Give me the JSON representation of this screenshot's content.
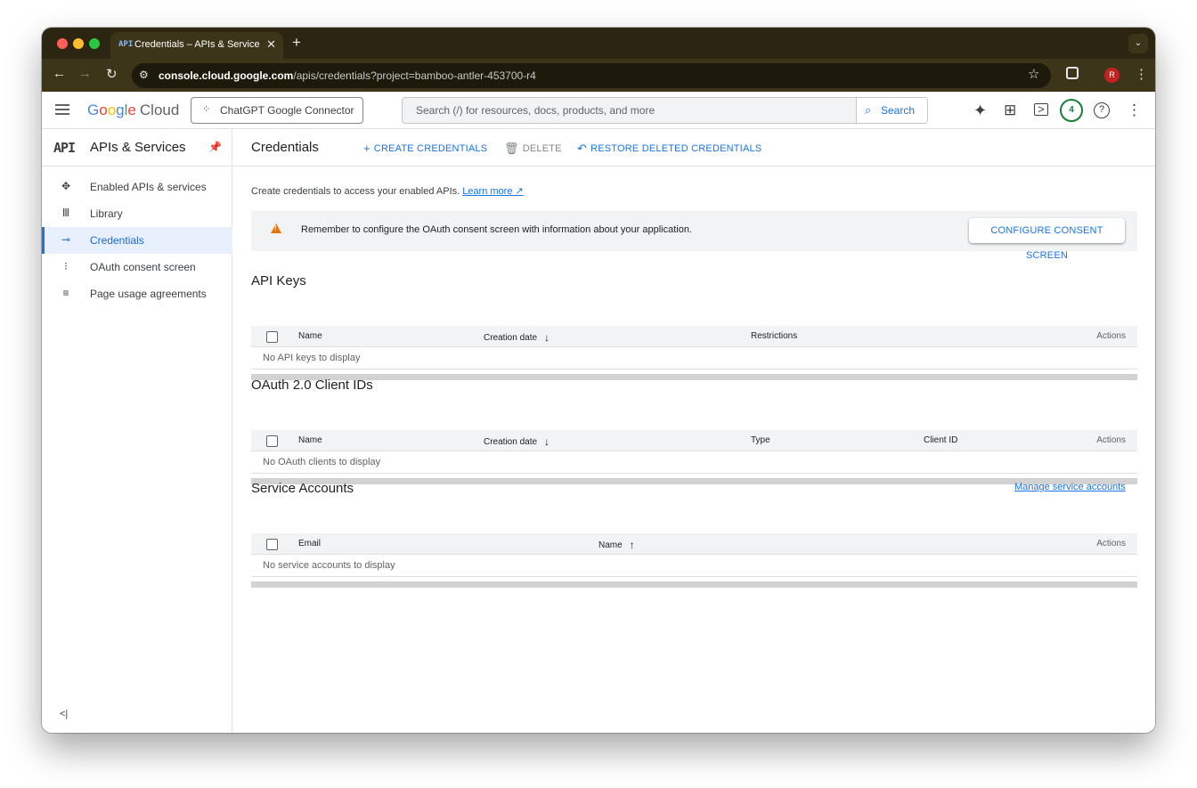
{
  "browser": {
    "tab_title": "Credentials – APIs & Services",
    "tab_favicon": "API",
    "url_host": "console.cloud.google.com",
    "url_path": "/apis/credentials?project=bamboo-antler-453700-r4",
    "avatar_letter": "R"
  },
  "header": {
    "logo_google": [
      "G",
      "o",
      "o",
      "g",
      "l",
      "e"
    ],
    "logo_cloud": "Cloud",
    "project_name": "ChatGPT Google Connector",
    "search_placeholder": "Search (/) for resources, docs, products, and more",
    "search_button": "Search",
    "notification_count": "4"
  },
  "sidebar": {
    "api_logo": "API",
    "title": "APIs & Services",
    "items": [
      {
        "label": "Enabled APIs & services",
        "icon": "enabled-apis-icon"
      },
      {
        "label": "Library",
        "icon": "library-icon"
      },
      {
        "label": "Credentials",
        "icon": "key-icon",
        "active": true
      },
      {
        "label": "OAuth consent screen",
        "icon": "oauth-consent-icon"
      },
      {
        "label": "Page usage agreements",
        "icon": "agreements-icon"
      }
    ]
  },
  "main": {
    "title": "Credentials",
    "toolbar": {
      "create": "CREATE CREDENTIALS",
      "delete": "DELETE",
      "restore": "RESTORE DELETED CREDENTIALS"
    },
    "intro_text": "Create credentials to access your enabled APIs.",
    "learn_more": "Learn more",
    "banner_text": "Remember to configure the OAuth consent screen with information about your application.",
    "banner_button": "CONFIGURE CONSENT SCREEN",
    "api_keys": {
      "title": "API Keys",
      "columns": [
        "Name",
        "Creation date",
        "Restrictions",
        "Actions"
      ],
      "empty": "No API keys to display"
    },
    "oauth": {
      "title": "OAuth 2.0 Client IDs",
      "columns": [
        "Name",
        "Creation date",
        "Type",
        "Client ID",
        "Actions"
      ],
      "empty": "No OAuth clients to display"
    },
    "service_accounts": {
      "title": "Service Accounts",
      "manage_link": "Manage service accounts",
      "columns": [
        "Email",
        "Name",
        "Actions"
      ],
      "empty": "No service accounts to display"
    }
  },
  "colors": {
    "accent": "#1a73e8",
    "warning": "#e8710a",
    "chrome_frame": "#2b2511"
  }
}
